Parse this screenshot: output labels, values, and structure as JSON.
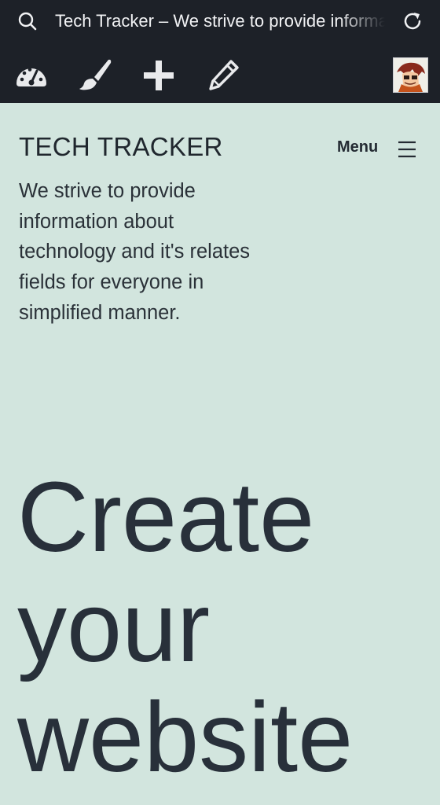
{
  "browser": {
    "page_title": "Tech Tracker – We strive to provide information about technology and it's relates fields for everyone in simplified manner.",
    "icons": {
      "search": "search-icon",
      "reload": "reload-icon"
    }
  },
  "admin_toolbar": {
    "items": [
      {
        "icon": "dashboard-gauge-icon"
      },
      {
        "icon": "customize-brush-icon"
      },
      {
        "icon": "new-plus-icon"
      },
      {
        "icon": "edit-pencil-icon"
      }
    ],
    "avatar": "user-avatar"
  },
  "site": {
    "title": "TECH TRACKER",
    "menu_label": "Menu",
    "tagline": "We strive to provide information about technology and it's relates fields for everyone in simplified manner."
  },
  "hero": {
    "lines": [
      "Create",
      "your",
      "website"
    ]
  },
  "colors": {
    "topbar_bg": "#1d2128",
    "page_bg": "#d2e5de",
    "text_dark": "#28303a",
    "icon_light": "#e9eaec"
  }
}
